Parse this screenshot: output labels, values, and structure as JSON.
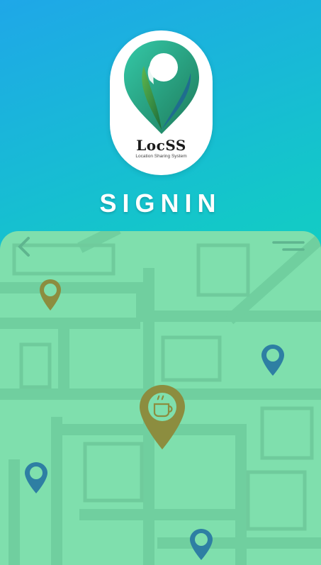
{
  "app": {
    "logo_text": "LocSS",
    "logo_subtitle": "Location Sharing System",
    "screen_title": "SIGNIN"
  },
  "map": {
    "pins": [
      {
        "name": "map-pin-olive-small",
        "color": "#8c8d3f"
      },
      {
        "name": "map-pin-blue-right",
        "color": "#2e7fa3"
      },
      {
        "name": "map-pin-cafe",
        "color": "#8c8d3f",
        "icon": "coffee-cup-icon"
      },
      {
        "name": "map-pin-blue-left",
        "color": "#2e7fa3"
      },
      {
        "name": "map-pin-blue-bottom",
        "color": "#2e7fa3"
      }
    ],
    "icons": [
      "back-chevron-icon",
      "menu-icon"
    ]
  },
  "colors": {
    "gradient_start": "#1fa7e8",
    "gradient_end": "#12e2ad",
    "map_background": "#7fdfad",
    "map_road": "#70cf9f",
    "pin_olive": "#8c8d3f",
    "pin_blue": "#2e7fa3"
  }
}
